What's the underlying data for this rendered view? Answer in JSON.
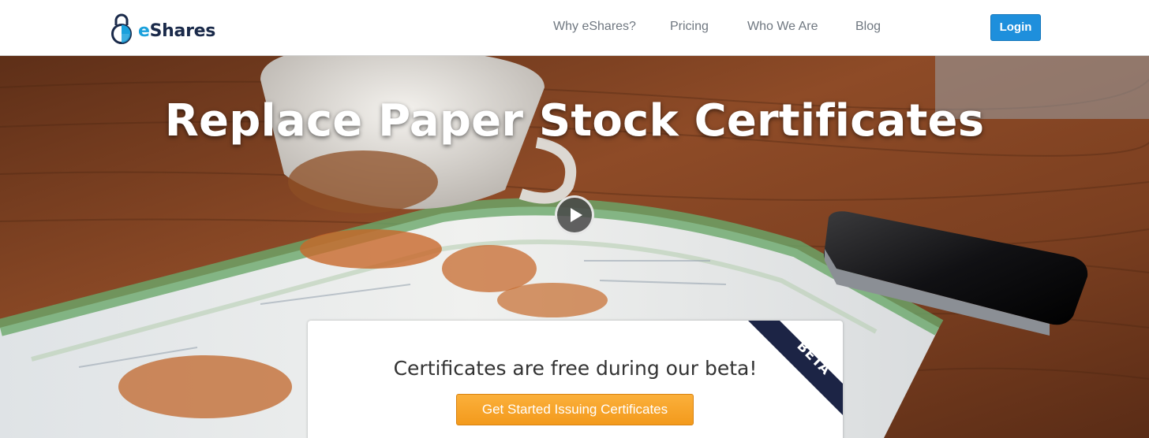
{
  "brand": {
    "logo_prefix": "e",
    "logo_rest": "Shares",
    "logo_icon": "padlock-icon",
    "colors": {
      "navy": "#1a2a4a",
      "accent": "#1ba1dc"
    }
  },
  "nav": {
    "items": [
      {
        "label": "Why eShares?"
      },
      {
        "label": "Pricing"
      },
      {
        "label": "Who We Are"
      },
      {
        "label": "Blog"
      }
    ],
    "login_label": "Login",
    "login_color": "#1e8fdc"
  },
  "hero": {
    "title": "Replace Paper Stock Certificates",
    "play_icon": "play-icon"
  },
  "beta_card": {
    "heading": "Certificates are free during our beta!",
    "cta_label": "Get Started Issuing Certificates",
    "cta_color": "#f7a52a",
    "ribbon_label": "BETA",
    "ribbon_color": "#1c2445"
  }
}
